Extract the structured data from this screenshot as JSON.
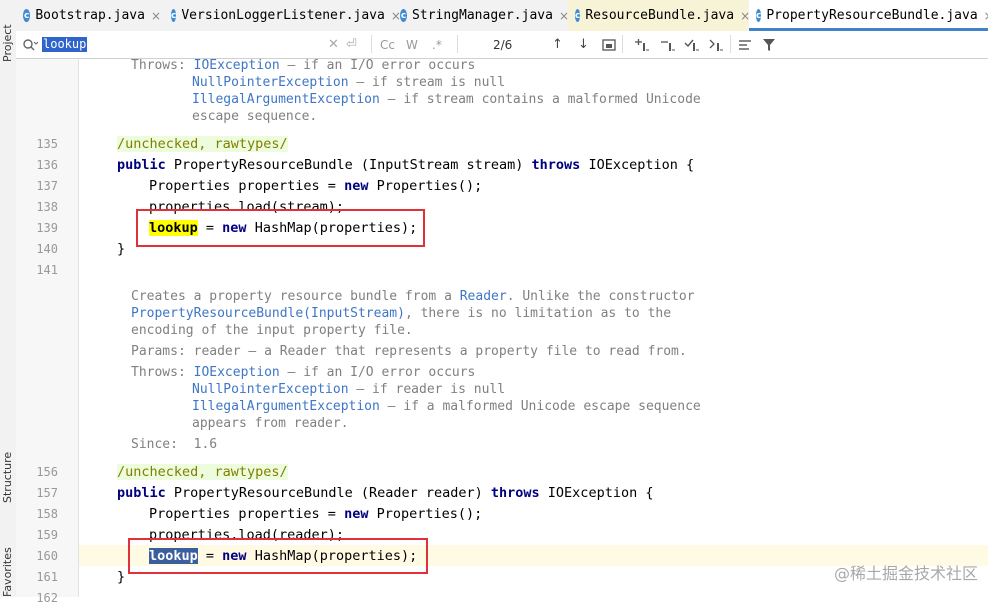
{
  "tabs": [
    {
      "label": "Bootstrap.java",
      "close": "×"
    },
    {
      "label": "VersionLoggerListener.java",
      "close": "×"
    },
    {
      "label": "StringManager.java",
      "close": "×"
    },
    {
      "label": "ResourceBundle.java",
      "close": "×"
    },
    {
      "label": "PropertyResourceBundle.java",
      "close": "×"
    }
  ],
  "file_icon_letter": "c",
  "sidebar": {
    "project": "Project",
    "structure": "Structure",
    "favorites": "Favorites"
  },
  "search": {
    "query": "lookup",
    "match_case": "Cc",
    "words": "W",
    "regex": ".*",
    "count": "2/6"
  },
  "gutter": {
    "lines": [
      "135",
      "136",
      "137",
      "138",
      "139",
      "140",
      "141",
      "156",
      "157",
      "158",
      "159",
      "160",
      "161",
      "162"
    ]
  },
  "code": {
    "doc1": {
      "throws_label": "Throws:",
      "t1_link": "IOException",
      "t1_text": " – if an I/O error occurs",
      "t2_link": "NullPointerException",
      "t2_text": " – if stream is null",
      "t3_link": "IllegalArgumentException",
      "t3_text": " – if stream contains a malformed Unicode",
      "t3_cont": "escape sequence."
    },
    "ann": "/unchecked, rawtypes/",
    "public": "public",
    "ctor1_sig": " PropertyResourceBundle (InputStream stream) ",
    "throws": "throws",
    "exc_brace": " IOException {",
    "props_decl_a": "Properties properties = ",
    "new": "new",
    "props_decl_b": " Properties();",
    "load_stream": "properties.load(stream);",
    "lookup": "lookup",
    "lookup_rest_a": " = ",
    "lookup_rest_b": " HashMap(properties);",
    "close_brace": "}",
    "doc2": {
      "l1a": "Creates a property resource bundle from a ",
      "l1_link": "Reader",
      "l1b": ". Unlike the constructor",
      "l2_link": "PropertyResourceBundle(InputStream)",
      "l2b": ", there is no limitation as to the",
      "l3": "encoding of the input property file.",
      "params_label": "Params:",
      "params_text": " reader – a Reader that represents a property file to read from.",
      "throws_label": "Throws:",
      "t1_link": "IOException",
      "t1_text": " – if an I/O error occurs",
      "t2_link": "NullPointerException",
      "t2_text": " – if reader is null",
      "t3_link": "IllegalArgumentException",
      "t3_text": " – if a malformed Unicode escape sequence",
      "t3_cont": "appears from reader.",
      "since_label": "Since:",
      "since_value": "  1.6"
    },
    "ctor2_sig": " PropertyResourceBundle (Reader reader) ",
    "load_reader": "properties.load(reader);"
  },
  "watermark": "@稀土掘金技术社区",
  "colors": {
    "keyword": "#000080",
    "link": "#3f76c6",
    "highlight_current": "#ffff00",
    "highlight_other": "#3a5f9c",
    "annotation_box": "#e0313b"
  }
}
